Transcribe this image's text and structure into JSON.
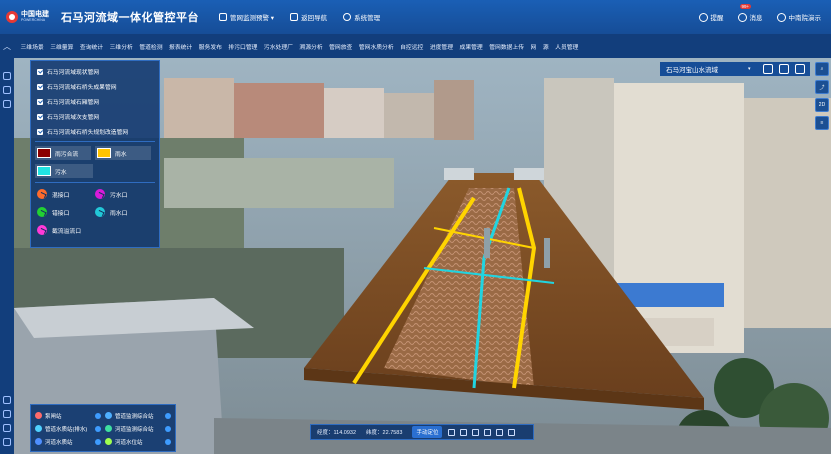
{
  "header": {
    "logo_cn": "中国电建",
    "logo_en": "POWERCHINA",
    "title": "石马河流域一体化管控平台",
    "nav": [
      {
        "label": "管网监测预警 ▾",
        "icon": "network-monitor-icon"
      },
      {
        "label": "返回导航",
        "icon": "return-nav-icon"
      },
      {
        "label": "系统管理",
        "icon": "gear-icon"
      }
    ],
    "right": {
      "report_label": "提醒",
      "messages_label": "消息",
      "messages_badge": "99+",
      "user_label": "中南院演示"
    }
  },
  "menubar": {
    "items": [
      "三维场景",
      "三维量算",
      "查询统计",
      "三维分析",
      "管道检测",
      "报表统计",
      "服务发布",
      "排污口管理",
      "污水处理厂",
      "溯源分析",
      "管网旅查",
      "管网水质分析",
      "自控远控",
      "进度管理",
      "成果管理",
      "管网数据上传",
      "网",
      "源",
      "人员管理"
    ]
  },
  "legend": {
    "layers": [
      "石马河流域现状管网",
      "石马河流域石桥头成果管网",
      "石马河流域石厢管网",
      "石马河流域次支管网",
      "石马河流域石桥头规划改造管网"
    ],
    "pipe_types": [
      {
        "label": "雨污合流",
        "color": "#8b0000"
      },
      {
        "label": "雨水",
        "color": "#ffc400"
      },
      {
        "label": "污水",
        "color": "#21e3e3"
      }
    ],
    "outlets": [
      {
        "label": "混接口",
        "color": "#ff6b2c"
      },
      {
        "label": "污水口",
        "color": "#d81bd8"
      },
      {
        "label": "错接口",
        "color": "#22d132"
      },
      {
        "label": "雨水口",
        "color": "#22c8d8"
      },
      {
        "label": "截流溢流口",
        "color": "#ff3ad8"
      }
    ]
  },
  "basin": {
    "selected": "石马河宝山水流域"
  },
  "stations": {
    "rows": [
      [
        {
          "label": "泵闸站",
          "color": "#ff6b6b"
        },
        {
          "label": "管道监测综合站",
          "color": "#4fb0ff"
        }
      ],
      [
        {
          "label": "管道水质站(排水)",
          "color": "#4fd0ff"
        },
        {
          "label": "河道监测综合站",
          "color": "#3ee0a0"
        }
      ],
      [
        {
          "label": "河道水质站",
          "color": "#4f8fff"
        },
        {
          "label": "河道水位站",
          "color": "#9fff4f"
        }
      ]
    ]
  },
  "status": {
    "lng": "经度：114.0932",
    "lat": "纬度：22.7583",
    "locate_label": "手动定位"
  }
}
